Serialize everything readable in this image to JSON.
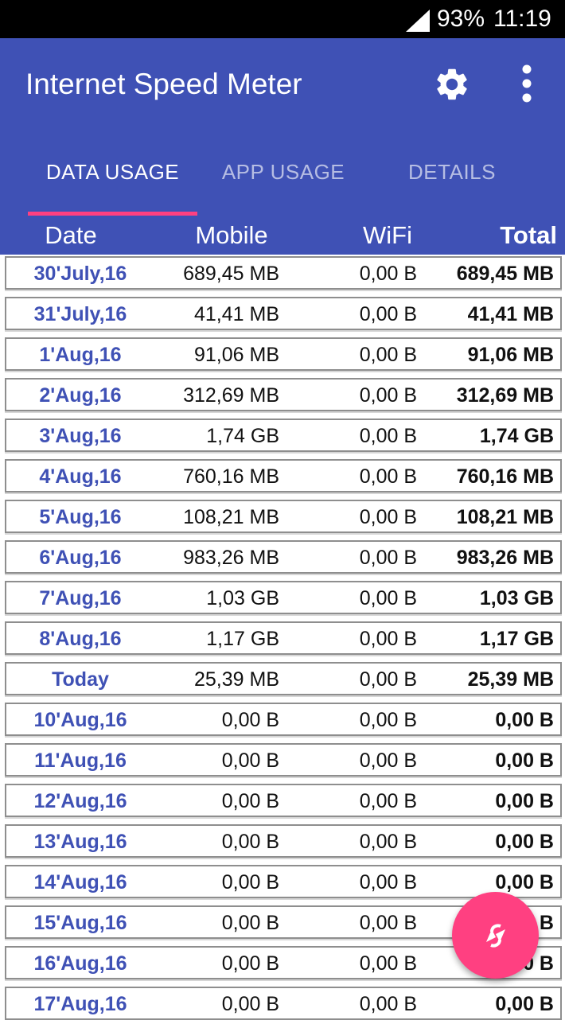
{
  "status_bar": {
    "battery": "93%",
    "time": "11:19",
    "signal_icon": "signal-icon"
  },
  "app_bar": {
    "title": "Internet Speed Meter",
    "settings_icon": "gear-icon",
    "menu_icon": "overflow-menu-icon"
  },
  "tabs": [
    {
      "label": "DATA USAGE",
      "active": true
    },
    {
      "label": "APP USAGE",
      "active": false
    },
    {
      "label": "DETAILS",
      "active": false
    }
  ],
  "columns": {
    "date": "Date",
    "mobile": "Mobile",
    "wifi": "WiFi",
    "total": "Total"
  },
  "rows": [
    {
      "date": "30'July,16",
      "mobile": "689,45 MB",
      "wifi": "0,00 B",
      "total": "689,45 MB"
    },
    {
      "date": "31'July,16",
      "mobile": "41,41 MB",
      "wifi": "0,00 B",
      "total": "41,41 MB"
    },
    {
      "date": "1'Aug,16",
      "mobile": "91,06 MB",
      "wifi": "0,00 B",
      "total": "91,06 MB"
    },
    {
      "date": "2'Aug,16",
      "mobile": "312,69 MB",
      "wifi": "0,00 B",
      "total": "312,69 MB"
    },
    {
      "date": "3'Aug,16",
      "mobile": "1,74 GB",
      "wifi": "0,00 B",
      "total": "1,74 GB"
    },
    {
      "date": "4'Aug,16",
      "mobile": "760,16 MB",
      "wifi": "0,00 B",
      "total": "760,16 MB"
    },
    {
      "date": "5'Aug,16",
      "mobile": "108,21 MB",
      "wifi": "0,00 B",
      "total": "108,21 MB"
    },
    {
      "date": "6'Aug,16",
      "mobile": "983,26 MB",
      "wifi": "0,00 B",
      "total": "983,26 MB"
    },
    {
      "date": "7'Aug,16",
      "mobile": "1,03 GB",
      "wifi": "0,00 B",
      "total": "1,03 GB"
    },
    {
      "date": "8'Aug,16",
      "mobile": "1,17 GB",
      "wifi": "0,00 B",
      "total": "1,17 GB"
    },
    {
      "date": "Today",
      "mobile": "25,39 MB",
      "wifi": "0,00 B",
      "total": "25,39 MB"
    },
    {
      "date": "10'Aug,16",
      "mobile": "0,00 B",
      "wifi": "0,00 B",
      "total": "0,00 B"
    },
    {
      "date": "11'Aug,16",
      "mobile": "0,00 B",
      "wifi": "0,00 B",
      "total": "0,00 B"
    },
    {
      "date": "12'Aug,16",
      "mobile": "0,00 B",
      "wifi": "0,00 B",
      "total": "0,00 B"
    },
    {
      "date": "13'Aug,16",
      "mobile": "0,00 B",
      "wifi": "0,00 B",
      "total": "0,00 B"
    },
    {
      "date": "14'Aug,16",
      "mobile": "0,00 B",
      "wifi": "0,00 B",
      "total": "0,00 B"
    },
    {
      "date": "15'Aug,16",
      "mobile": "0,00 B",
      "wifi": "0,00 B",
      "total": "0,00 B"
    },
    {
      "date": "16'Aug,16",
      "mobile": "0,00 B",
      "wifi": "0,00 B",
      "total": "0,00 B"
    },
    {
      "date": "17'Aug,16",
      "mobile": "0,00 B",
      "wifi": "0,00 B",
      "total": "0,00 B"
    }
  ],
  "fab": {
    "icon": "refresh-arrows-icon"
  },
  "colors": {
    "primary": "#3f51b5",
    "accent": "#ff4081",
    "status_bar": "#000000",
    "date_text": "#3f51b5"
  }
}
